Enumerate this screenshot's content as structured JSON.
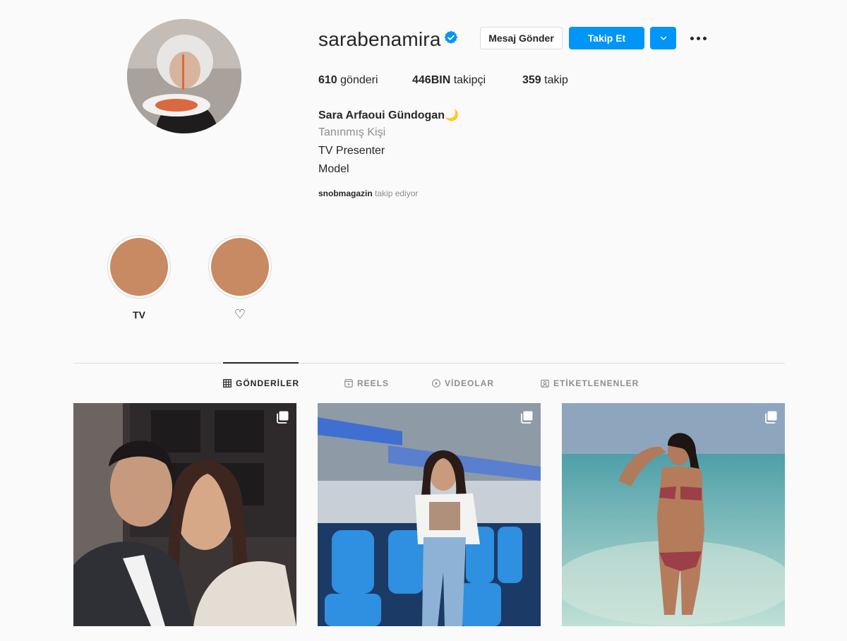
{
  "profile": {
    "username": "sarabenamira",
    "verified": true,
    "full_name": "Sara Arfaoui Gündogan🌙",
    "category": "Tanınmış Kişi",
    "bio_lines": [
      "TV Presenter",
      "Model"
    ],
    "followed_by_user": "snobmagazin",
    "followed_by_suffix": "takip ediyor"
  },
  "actions": {
    "message_label": "Mesaj Gönder",
    "follow_label": "Takip Et"
  },
  "stats": {
    "posts_count": "610",
    "posts_label": "gönderi",
    "followers_count": "446BIN",
    "followers_label": "takipçi",
    "following_count": "359",
    "following_label": "takip"
  },
  "highlights": [
    {
      "label": "TV",
      "color": "#c88a62"
    },
    {
      "label": "♡",
      "color": "#c88a62"
    }
  ],
  "tabs": [
    {
      "label": "GÖNDERİLER",
      "icon": "grid-icon",
      "active": true
    },
    {
      "label": "REELS",
      "icon": "reels-icon",
      "active": false
    },
    {
      "label": "VİDEOLAR",
      "icon": "play-icon",
      "active": false
    },
    {
      "label": "ETİKETLENENLER",
      "icon": "tagged-icon",
      "active": false
    }
  ],
  "posts": [
    {
      "type": "carousel",
      "icon": "multiple-images-icon"
    },
    {
      "type": "carousel",
      "icon": "multiple-images-icon"
    },
    {
      "type": "carousel",
      "icon": "multiple-images-icon"
    }
  ],
  "colors": {
    "accent": "#0095f6",
    "text": "#262626",
    "secondary": "#8e8e8e",
    "border": "#dbdbdb",
    "background": "#fafafa"
  }
}
